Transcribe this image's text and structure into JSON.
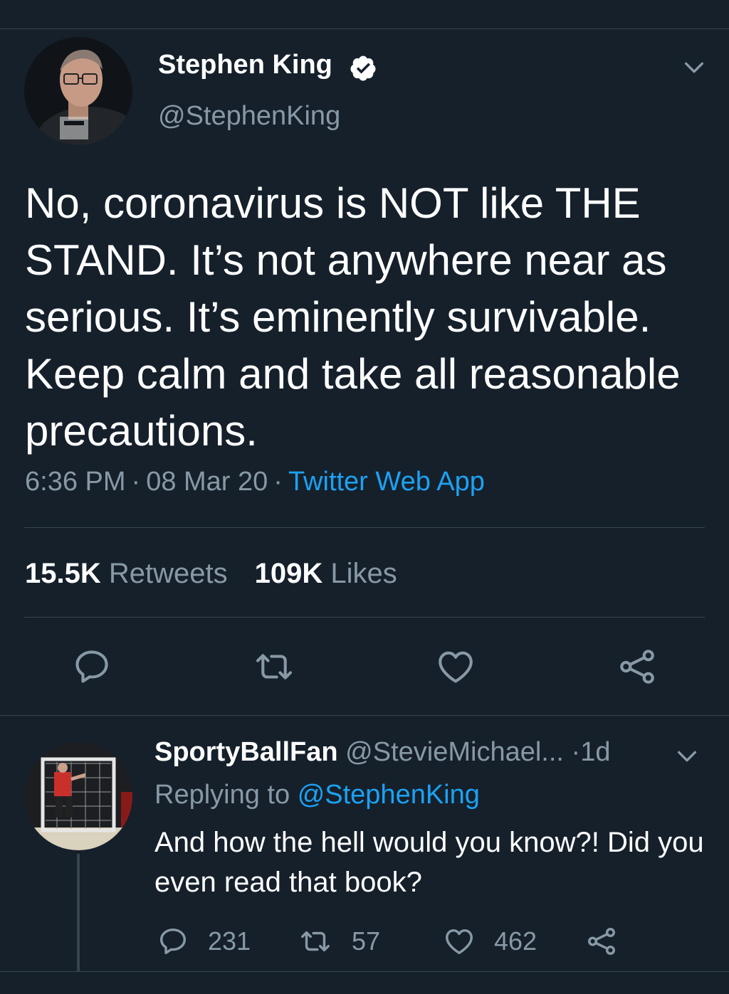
{
  "tweet": {
    "author_name": "Stephen King",
    "author_handle": "@StephenKing",
    "verified": true,
    "text": "No, coronavirus is NOT like THE STAND. It’s not anywhere near as serious. It’s eminently survivable. Keep calm and take all reasonable precautions.",
    "time": "6:36 PM",
    "date": "08 Mar 20",
    "separator": "·",
    "source": "Twitter Web App",
    "retweets_count": "15.5K",
    "retweets_label": "Retweets",
    "likes_count": "109K",
    "likes_label": "Likes"
  },
  "reply": {
    "author_name": "SportyBallFan",
    "author_handle": "@StevieMichael...",
    "separator": "·",
    "age": "1d",
    "replying_prefix": "Replying to",
    "replying_to": "@StephenKing",
    "text": "And how the hell would you know?! Did you even read that book?",
    "reply_count": "231",
    "retweet_count": "57",
    "like_count": "462"
  },
  "icons": {
    "verified": "verified-badge-icon",
    "more": "chevron-down-icon",
    "reply": "speech-bubble-icon",
    "retweet": "retweet-arrows-icon",
    "like": "heart-icon",
    "share": "share-nodes-icon"
  },
  "colors": {
    "background": "#15202b",
    "divider": "#38444d",
    "secondary_text": "#8899a6",
    "link": "#1da1f2",
    "primary_text": "#ffffff"
  }
}
